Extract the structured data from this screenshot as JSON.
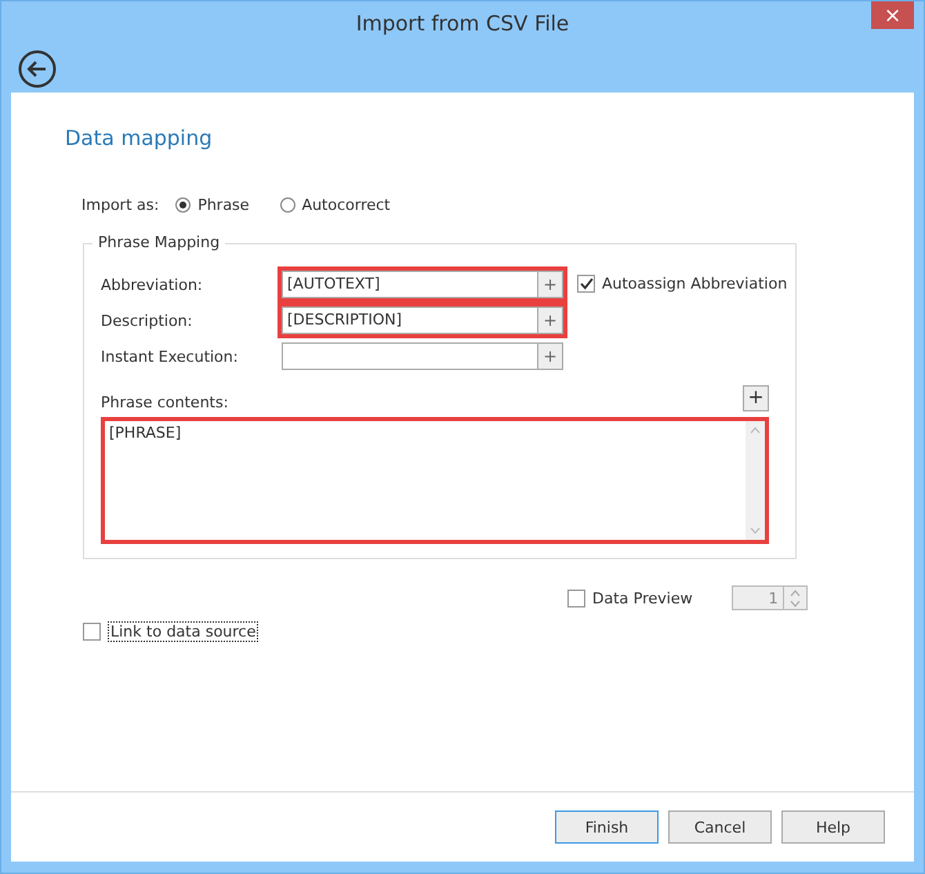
{
  "window": {
    "title": "Import from CSV File",
    "close_label": "×"
  },
  "heading": "Data mapping",
  "import_as": {
    "label": "Import as:",
    "options": [
      {
        "label": "Phrase",
        "selected": true
      },
      {
        "label": "Autocorrect",
        "selected": false
      }
    ]
  },
  "phrase_mapping": {
    "title": "Phrase Mapping",
    "fields": [
      {
        "label": "Abbreviation:",
        "value": "[AUTOTEXT]",
        "highlighted": true,
        "button": "+"
      },
      {
        "label": "Description:",
        "value": "[DESCRIPTION]",
        "highlighted": true,
        "button": "+"
      },
      {
        "label": "Instant Execution:",
        "highlighted": false,
        "button": "+"
      }
    ],
    "autoassign": {
      "label": "Autoassign Abbreviation",
      "checked": true
    },
    "contents": {
      "label": "Phrase contents:",
      "value": "[PHRASE]",
      "highlighted": true,
      "button": "+"
    }
  },
  "data_preview": {
    "label": "Data Preview",
    "checked": false,
    "value": "1"
  },
  "link_to_data_source": {
    "label": "Link to data source",
    "checked": false
  },
  "buttons": [
    {
      "label": "Finish",
      "default": true
    },
    {
      "label": "Cancel",
      "default": false
    },
    {
      "label": "Help",
      "default": false
    }
  ]
}
